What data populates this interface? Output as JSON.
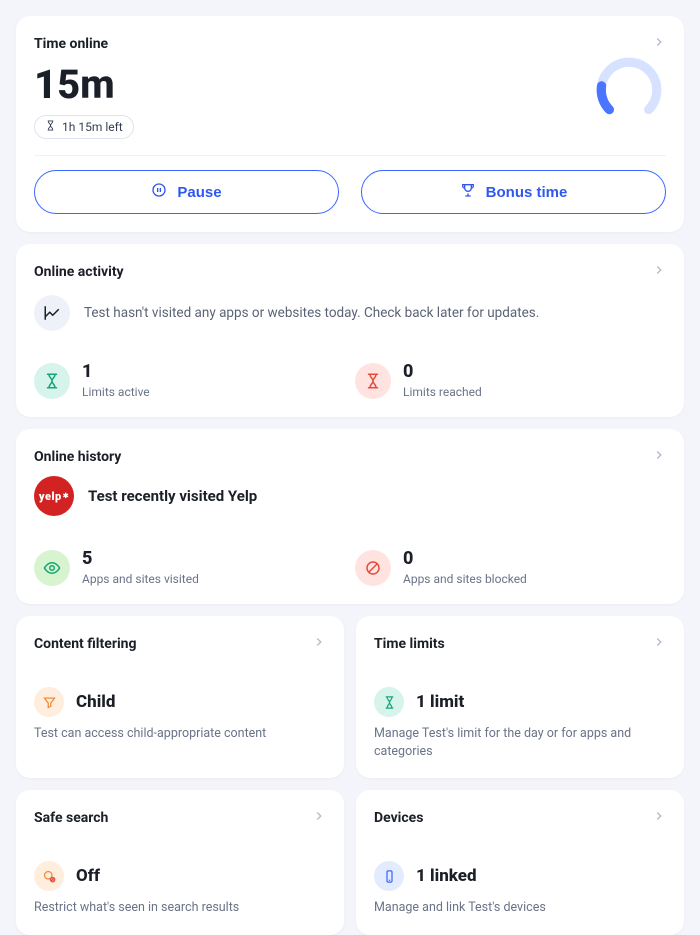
{
  "time_online": {
    "title": "Time online",
    "value": "15m",
    "remaining": "1h 15m left",
    "pause_label": "Pause",
    "bonus_label": "Bonus time",
    "progress_fraction": 0.17
  },
  "online_activity": {
    "title": "Online activity",
    "empty_message": "Test hasn't visited any apps or websites today. Check back later for updates.",
    "limits_active": {
      "count": "1",
      "label": "Limits active"
    },
    "limits_reached": {
      "count": "0",
      "label": "Limits reached"
    }
  },
  "online_history": {
    "title": "Online history",
    "recent_visit": "Test recently visited Yelp",
    "visited": {
      "count": "5",
      "label": "Apps and sites visited"
    },
    "blocked": {
      "count": "0",
      "label": "Apps and sites blocked"
    }
  },
  "content_filtering": {
    "title": "Content filtering",
    "value": "Child",
    "sub": "Test can access child-appropriate content"
  },
  "time_limits": {
    "title": "Time limits",
    "value": "1 limit",
    "sub": "Manage Test's limit for the day or for apps and categories"
  },
  "safe_search": {
    "title": "Safe search",
    "value": "Off",
    "sub": "Restrict what's seen in search results"
  },
  "devices": {
    "title": "Devices",
    "value": "1 linked",
    "sub": "Manage and link Test's devices"
  }
}
